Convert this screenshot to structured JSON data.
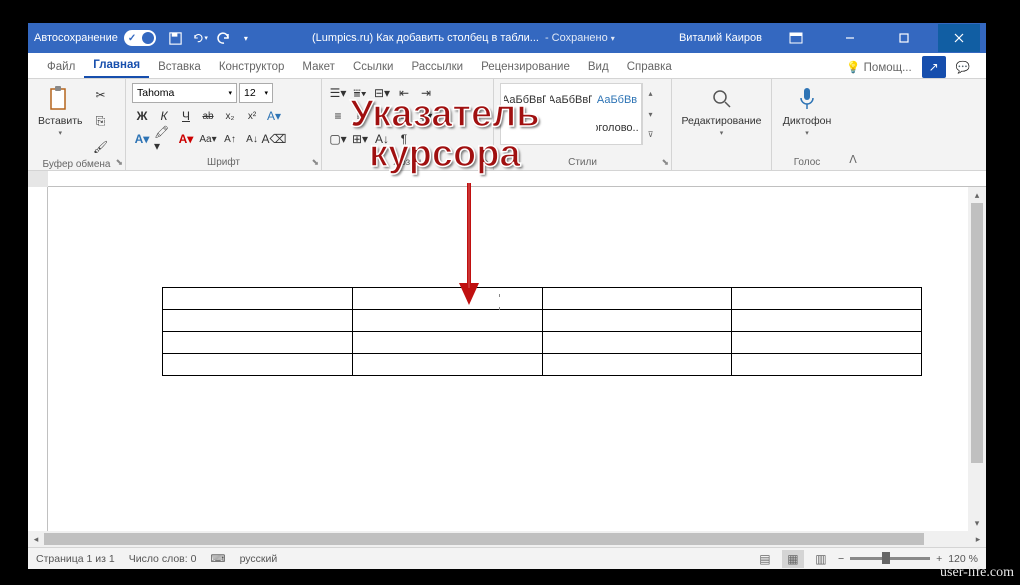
{
  "titlebar": {
    "autosave": "Автосохранение",
    "doc_title": "(Lumpics.ru) Как добавить столбец в табли...",
    "saved_status": "Сохранено",
    "user": "Виталий Каиров"
  },
  "tabs": {
    "file": "Файл",
    "home": "Главная",
    "insert": "Вставка",
    "design": "Конструктор",
    "layout": "Макет",
    "references": "Ссылки",
    "mailings": "Рассылки",
    "review": "Рецензирование",
    "view": "Вид",
    "help": "Справка",
    "help_btn": "Помощ..."
  },
  "ribbon": {
    "clipboard": {
      "label": "Буфер обмена",
      "paste": "Вставить"
    },
    "font": {
      "label": "Шрифт",
      "name": "Tahoma",
      "size": "12",
      "bold": "Ж",
      "italic": "К",
      "underline": "Ч",
      "strike": "ab"
    },
    "paragraph": {
      "label": "Абзац"
    },
    "styles": {
      "label": "Стили",
      "style1": "АаБбВвГ",
      "style2": "АаБбВвГ",
      "style3": "АаБбВв",
      "heading": "оголово..."
    },
    "editing": {
      "label": "Редактирование"
    },
    "voice": {
      "label": "Голос",
      "dictate": "Диктофон"
    }
  },
  "statusbar": {
    "page": "Страница 1 из 1",
    "words": "Число слов: 0",
    "lang": "русский",
    "zoom": "120 %"
  },
  "annotation": {
    "line1": "Указатель",
    "line2": "курсора"
  },
  "watermark": "user-life.com",
  "table": {
    "rows": 4,
    "cols": 4
  }
}
